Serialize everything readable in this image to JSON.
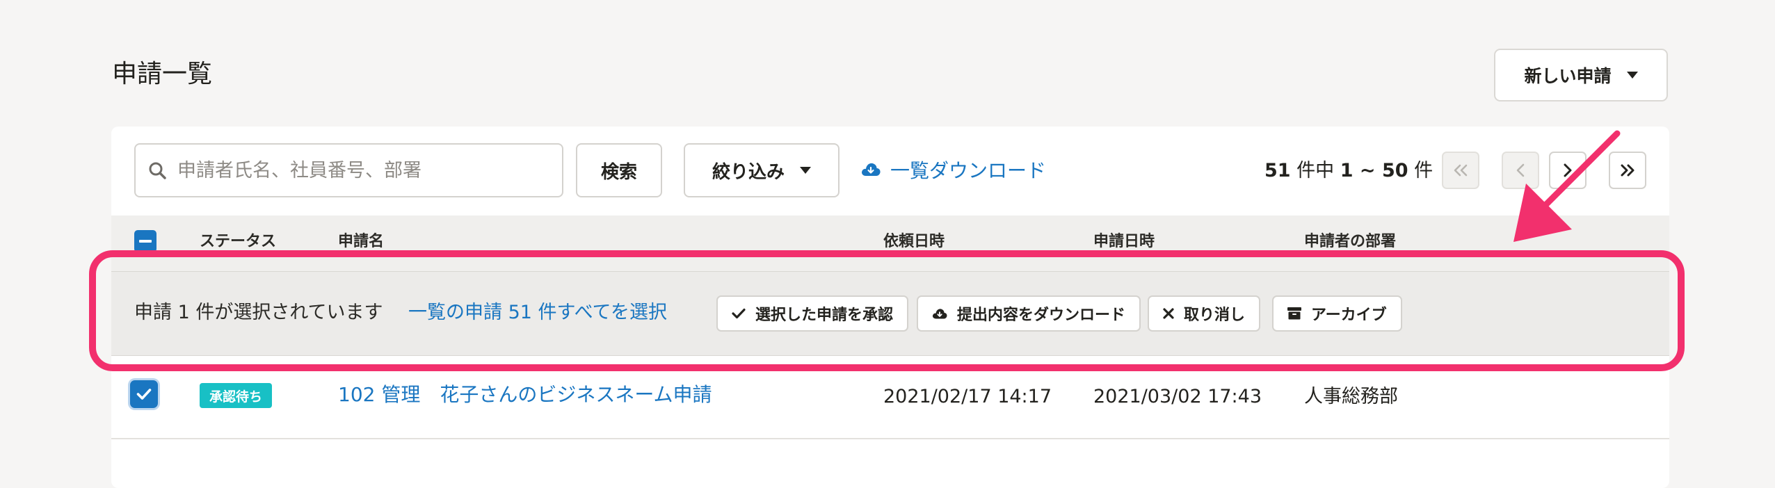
{
  "page": {
    "title": "申請一覧",
    "new_button": "新しい申請"
  },
  "toolbar": {
    "search_placeholder": "申請者氏名、社員番号、部署",
    "search_button": "検索",
    "filter_button": "絞り込み",
    "download_link": "一覧ダウンロード",
    "pager": {
      "total": "51",
      "total_suffix": " 件中 ",
      "range": "1 ~ 50",
      "range_suffix": " 件"
    }
  },
  "table": {
    "columns": [
      "ステータス",
      "申請名",
      "依頼日時",
      "申請日時",
      "申請者の部署"
    ]
  },
  "selection_bar": {
    "text": "申請 1 件が選択されています",
    "select_all": "一覧の申請 51 件すべてを選択",
    "actions": [
      "選択した申請を承認",
      "提出内容をダウンロード",
      "取り消し",
      "アーカイブ"
    ]
  },
  "rows": [
    {
      "status": "承認待ち",
      "name": "102 管理　花子さんのビジネスネーム申請",
      "requested_at": "2021/02/17 14:17",
      "submitted_at": "2021/03/02 17:43",
      "department": "人事総務部"
    }
  ],
  "colors": {
    "accent": "#1a76c1",
    "status_badge": "#18c0c5",
    "highlight": "#f2306d"
  }
}
